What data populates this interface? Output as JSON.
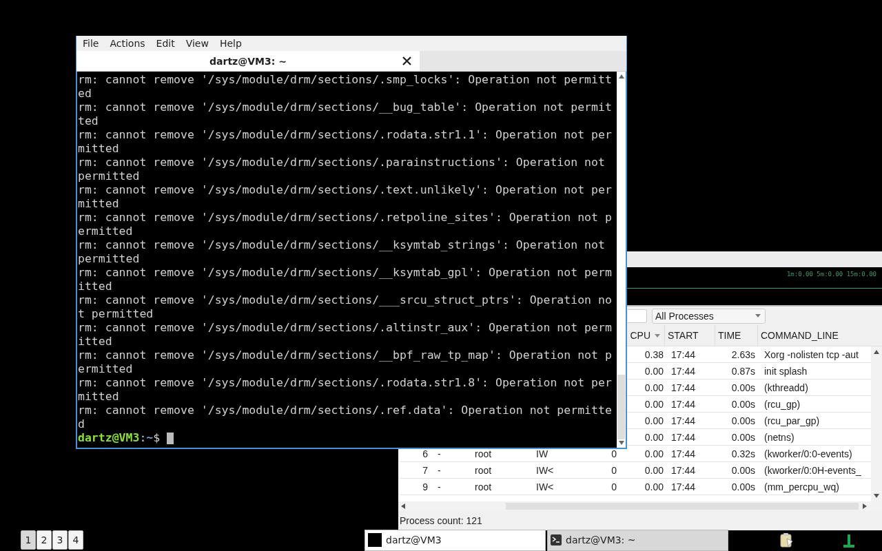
{
  "terminal": {
    "menu": [
      "File",
      "Actions",
      "Edit",
      "View",
      "Help"
    ],
    "tabs": [
      {
        "label": "dartz@VM3: ~",
        "selected": true
      }
    ],
    "lines": [
      "rm: cannot remove '/sys/module/drm/sections/.smp_locks': Operation not permitted",
      "rm: cannot remove '/sys/module/drm/sections/__bug_table': Operation not permitted",
      "rm: cannot remove '/sys/module/drm/sections/.rodata.str1.1': Operation not permitted",
      "rm: cannot remove '/sys/module/drm/sections/.parainstructions': Operation not permitted",
      "rm: cannot remove '/sys/module/drm/sections/.text.unlikely': Operation not permitted",
      "rm: cannot remove '/sys/module/drm/sections/.retpoline_sites': Operation not permitted",
      "rm: cannot remove '/sys/module/drm/sections/__ksymtab_strings': Operation not permitted",
      "rm: cannot remove '/sys/module/drm/sections/__ksymtab_gpl': Operation not permitted",
      "rm: cannot remove '/sys/module/drm/sections/___srcu_struct_ptrs': Operation not permitted",
      "rm: cannot remove '/sys/module/drm/sections/.altinstr_aux': Operation not permitted",
      "rm: cannot remove '/sys/module/drm/sections/__bpf_raw_tp_map': Operation not permitted",
      "rm: cannot remove '/sys/module/drm/sections/.rodata.str1.8': Operation not permitted",
      "rm: cannot remove '/sys/module/drm/sections/.ref.data': Operation not permitted"
    ],
    "prompt": {
      "user": "dartz@VM3",
      "separator": ":",
      "path": "~",
      "symbol": "$"
    }
  },
  "process_monitor": {
    "load_average": "1m:0.00 5m:0.00 15m:0.00",
    "filter": {
      "value": "All Processes"
    },
    "columns": [
      "CPU",
      "START",
      "TIME",
      "COMMAND_LINE"
    ],
    "rows": [
      {
        "cpu": "0.38",
        "start": "17:44",
        "time": "2.63s",
        "command": "Xorg -nolisten tcp -aut"
      },
      {
        "cpu": "0.00",
        "start": "17:44",
        "time": "0.87s",
        "command": "init splash"
      },
      {
        "cpu": "0.00",
        "start": "17:44",
        "time": "0.00s",
        "command": "(kthreadd)"
      },
      {
        "cpu": "0.00",
        "start": "17:44",
        "time": "0.00s",
        "command": "(rcu_gp)"
      },
      {
        "cpu": "0.00",
        "start": "17:44",
        "time": "0.00s",
        "command": "(rcu_par_gp)"
      },
      {
        "cpu": "0.00",
        "start": "17:44",
        "time": "0.00s",
        "command": "(netns)"
      },
      {
        "pid": "6",
        "column_2": "-",
        "user": "root",
        "state": "IW",
        "column_5": "0",
        "cpu": "0.00",
        "start": "17:44",
        "time": "0.32s",
        "command": "(kworker/0:0-events)"
      },
      {
        "pid": "7",
        "column_2": "-",
        "user": "root",
        "state": "IW<",
        "column_5": "0",
        "cpu": "0.00",
        "start": "17:44",
        "time": "0.00s",
        "command": "(kworker/0:0H-events_"
      },
      {
        "pid": "9",
        "column_2": "-",
        "user": "root",
        "state": "IW<",
        "column_5": "0",
        "cpu": "0.00",
        "start": "17:44",
        "time": "0.00s",
        "command": "(mm_percpu_wq)"
      }
    ],
    "status": "Process count: 121"
  },
  "taskbar": {
    "workspaces": [
      {
        "label": "1",
        "selected": true
      },
      {
        "label": "2",
        "selected": false
      },
      {
        "label": "3",
        "selected": false
      },
      {
        "label": "4",
        "selected": false
      }
    ],
    "tasks": [
      {
        "label": "dartz@VM3",
        "selected": true,
        "kind": "blank"
      },
      {
        "label": "dartz@VM3: ~",
        "selected": false,
        "kind": "terminal"
      }
    ]
  }
}
